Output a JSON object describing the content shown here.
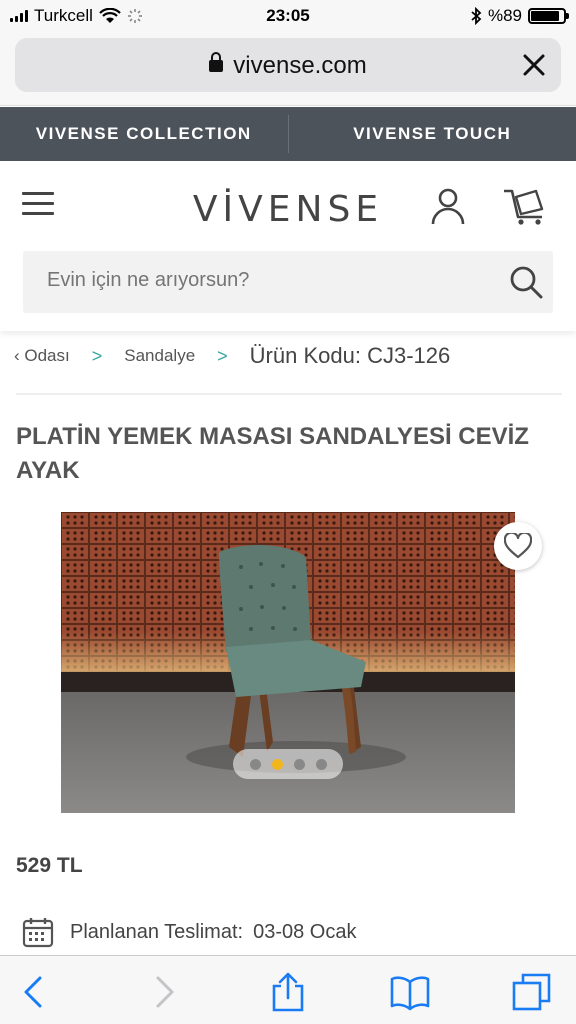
{
  "status": {
    "carrier": "Turkcell",
    "time": "23:05",
    "battery": "%89"
  },
  "browser": {
    "url": "vivense.com"
  },
  "collection_bar": {
    "left": "VIVENSE COLLECTION",
    "right": "VIVENSE TOUCH"
  },
  "header": {
    "logo": "VİVENSE",
    "search_placeholder": "Evin için ne arıyorsun?"
  },
  "breadcrumb": {
    "items": [
      "‹ Odası",
      "Sandalye"
    ],
    "sep": ">",
    "code": "Ürün Kodu: CJ3-126"
  },
  "product": {
    "title": "PLATİN YEMEK MASASI SANDALYESİ CEVİZ AYAK",
    "price": "529 TL",
    "delivery_label": "Planlanan Teslimat:",
    "delivery_value": "03-08 Ocak",
    "gallery": {
      "count": 4,
      "active_index": 1
    }
  },
  "colors": {
    "accent": "#f2b51b",
    "teal": "#3aa6a0",
    "dark_bar": "#4d535a"
  }
}
